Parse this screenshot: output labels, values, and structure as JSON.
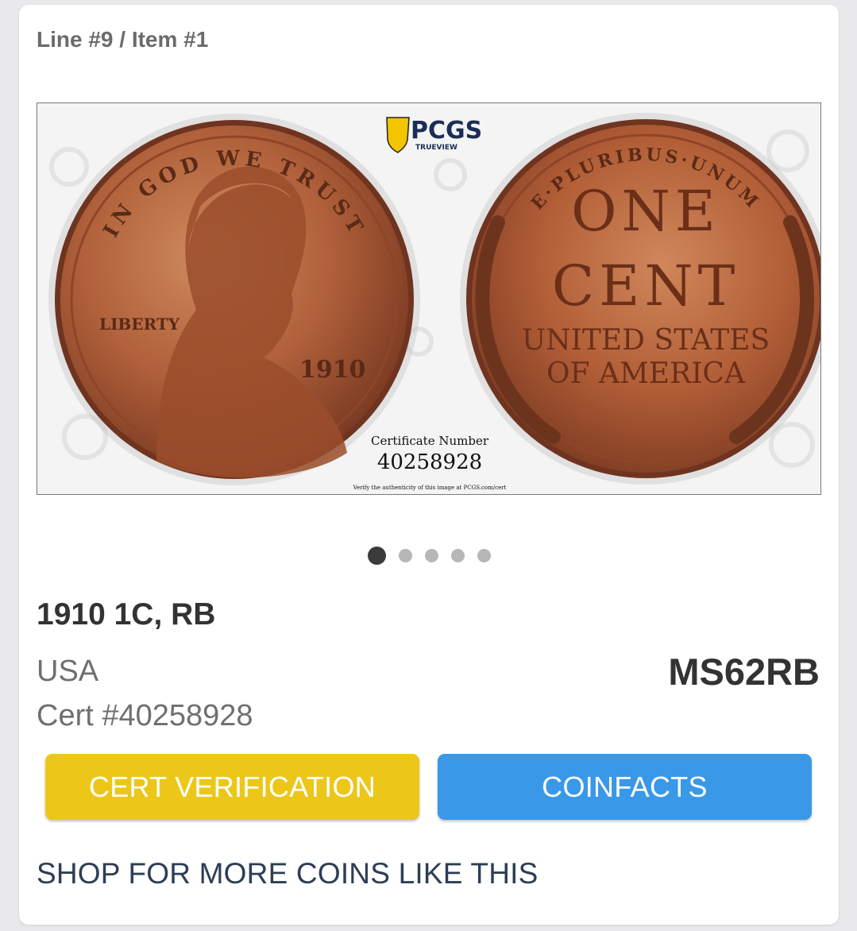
{
  "item": {
    "breadcrumb": "Line #9 / Item #1",
    "title": "1910 1C, RB",
    "country": "USA",
    "cert": "Cert #40258928",
    "grade": "MS62RB"
  },
  "image": {
    "brand": "PCGS",
    "brand_sub": "TRUEVIEW",
    "cert_label": "Certificate Number",
    "cert_number": "40258928",
    "verify_text": "Verify the authenticity of this image at PCGS.com/cert",
    "obverse_legend": "IN GOD WE TRUST",
    "obverse_liberty": "LIBERTY",
    "obverse_date": "1910",
    "reverse_legend": "E·PLURIBUS·UNUM",
    "reverse_line1": "ONE",
    "reverse_line2": "CENT",
    "reverse_line3": "UNITED STATES",
    "reverse_line4": "OF AMERICA"
  },
  "carousel": {
    "count": 5,
    "active": 1
  },
  "buttons": {
    "cert_verification": "CERT VERIFICATION",
    "coinfacts": "COINFACTS"
  },
  "shop_link": "SHOP FOR MORE COINS LIKE THIS",
  "colors": {
    "cert_button": "#ecc71a",
    "coinfacts_button": "#3998e8",
    "copper": "#b0603a"
  }
}
